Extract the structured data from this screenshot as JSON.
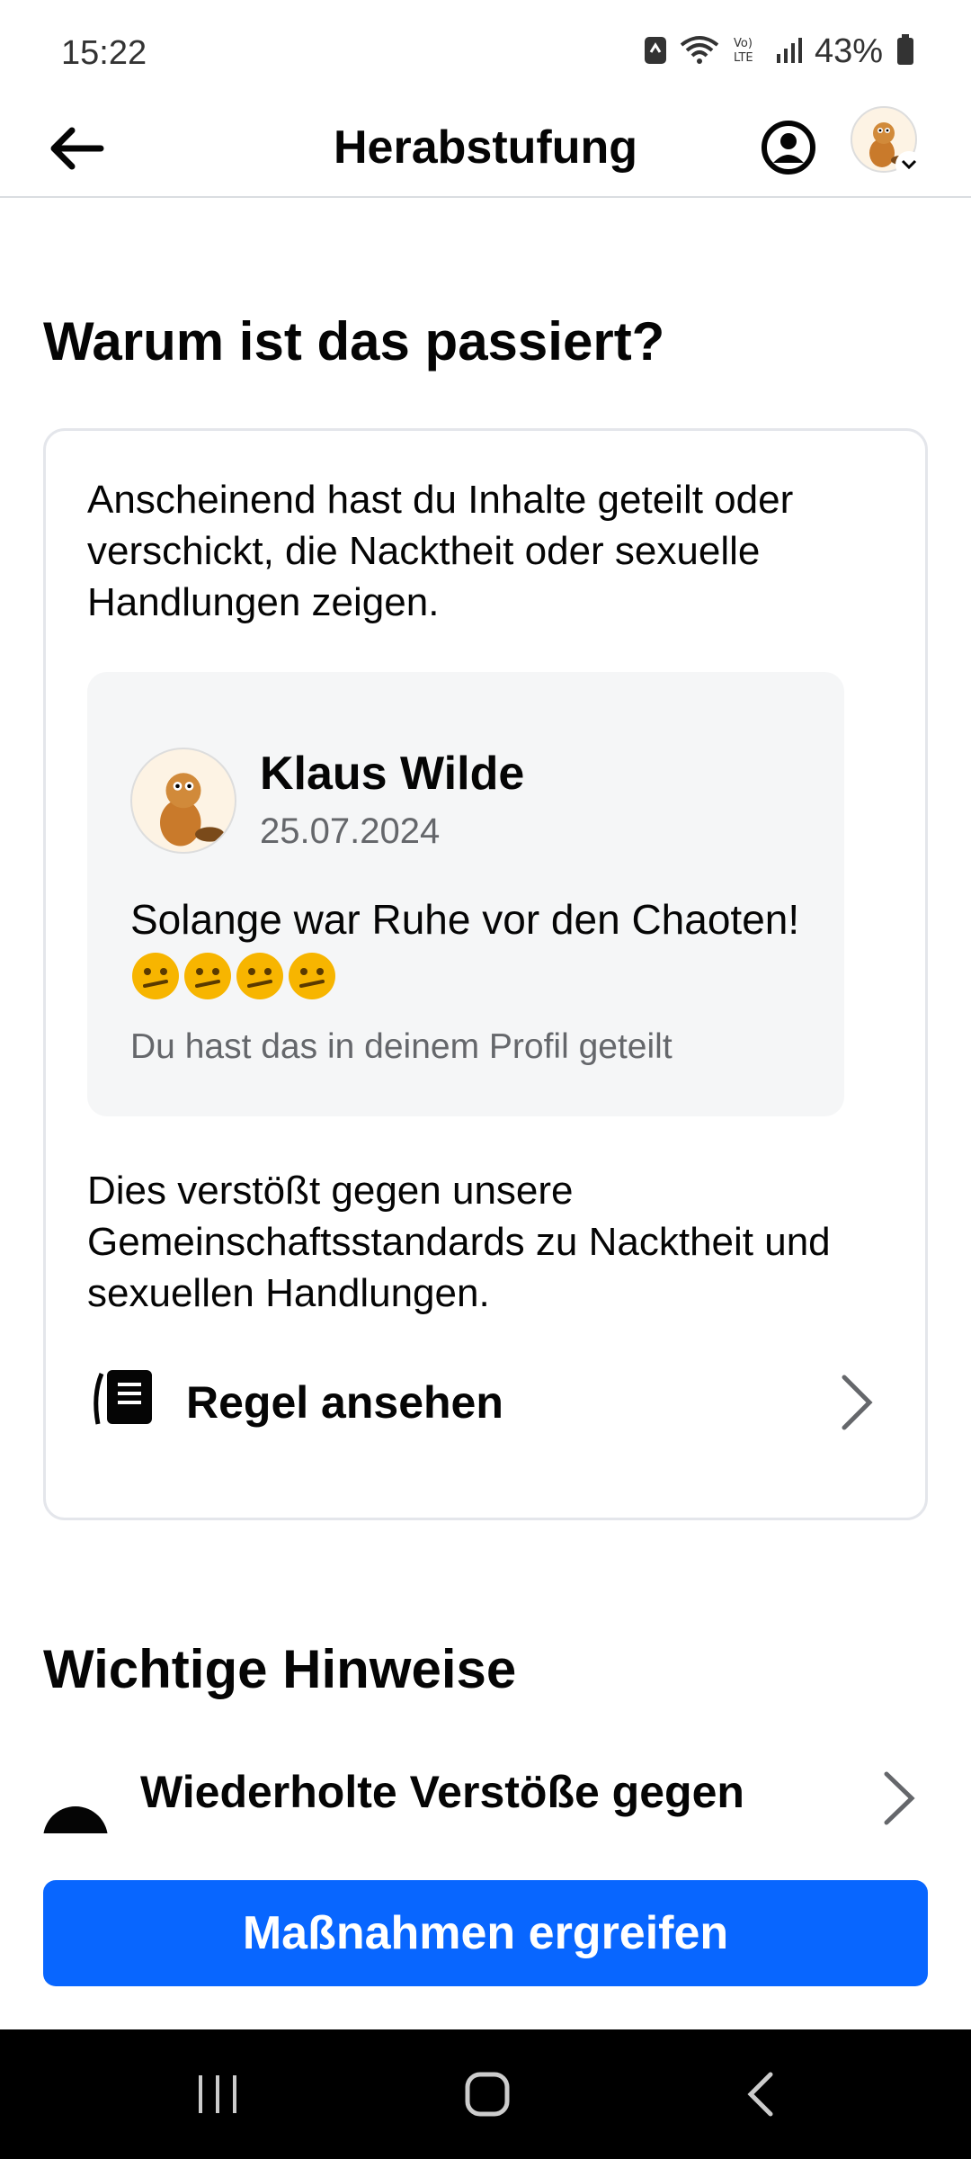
{
  "status_bar": {
    "time": "15:22",
    "battery_percent": "43%",
    "icons": [
      "sync-icon",
      "wifi-icon",
      "volte-icon",
      "signal-icon",
      "battery-icon"
    ]
  },
  "app_bar": {
    "title": "Herabstufung",
    "back_icon": "arrow-left-icon",
    "profile_icon": "account-circle-icon"
  },
  "section_why": {
    "heading": "Warum ist das passiert?",
    "intro": "Anscheinend hast du Inhalte geteilt oder verschickt, die Nacktheit oder sexuelle Handlungen zeigen.",
    "post": {
      "author": "Klaus Wilde",
      "date": "25.07.2024",
      "text": "Solange war Ruhe vor den Chaoten!",
      "emojis": [
        "🫤",
        "🫤",
        "🫤",
        "🫤"
      ],
      "note": "Du hast das in deinem Profil geteilt"
    },
    "violation": "Dies verstößt gegen unsere Gemeinschaftsstandards zu Nacktheit und sexuellen Handlungen.",
    "rule_link": "Regel ansehen"
  },
  "section_hints": {
    "heading": "Wichtige Hinweise",
    "item_label": "Wiederholte Verstöße gegen"
  },
  "action_button": "Maßnahmen ergreifen",
  "colors": {
    "accent": "#0866ff",
    "text": "#050505",
    "secondary_text": "#65676b",
    "post_bg": "#f5f6f7",
    "card_border": "#e4e6eb"
  }
}
